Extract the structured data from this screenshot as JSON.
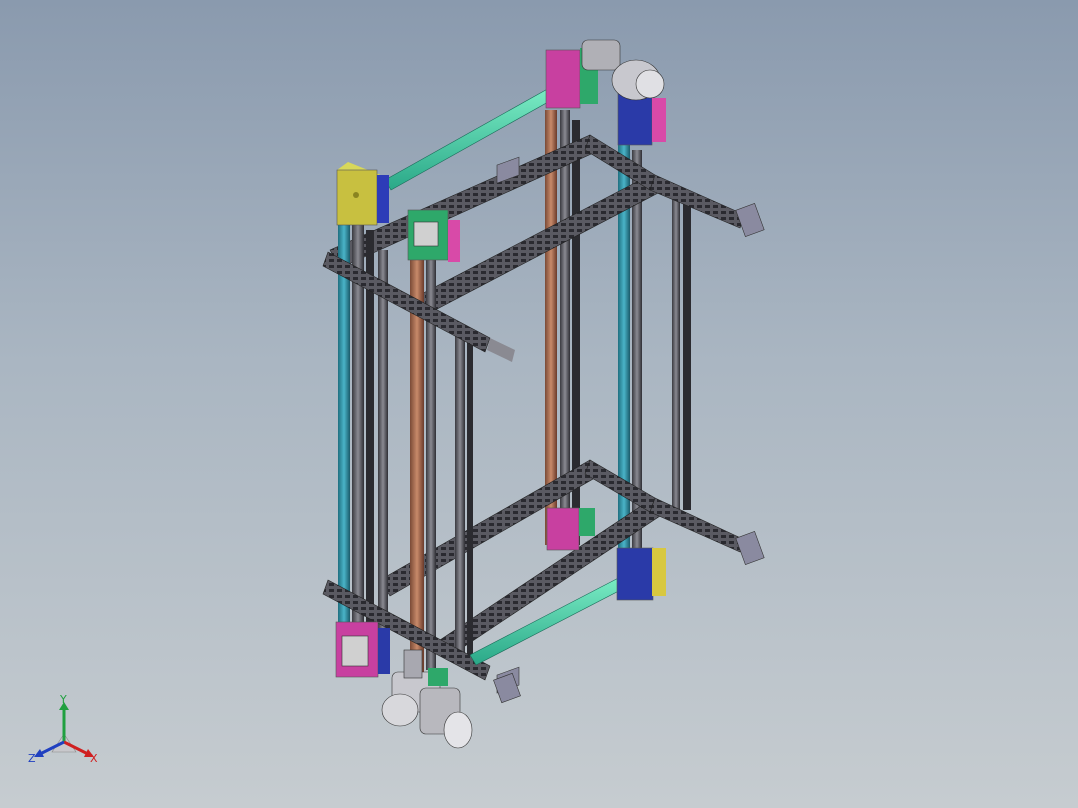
{
  "viewport": {
    "background_top": "#8a9aae",
    "background_bottom": "#c6ccd0"
  },
  "model": {
    "name_icon": "conveyor-lift-frame-assembly"
  },
  "triad": {
    "x_label": "X",
    "y_label": "Y",
    "z_label": "Z",
    "x_color": "#d02020",
    "y_color": "#20a040",
    "z_color": "#2040c0"
  }
}
